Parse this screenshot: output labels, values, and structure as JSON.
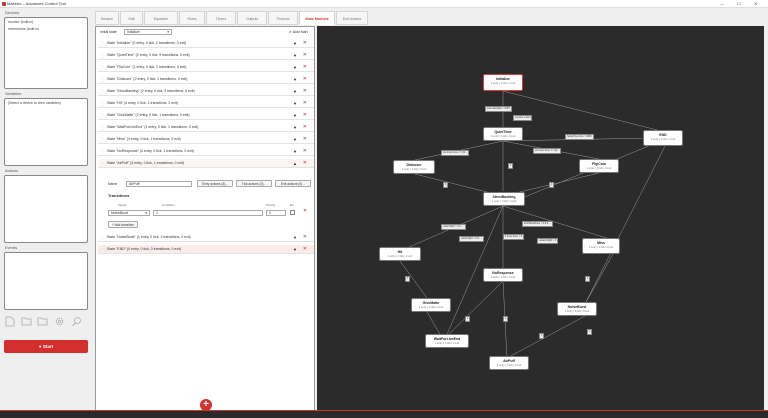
{
  "window": {
    "title": "Maestro – Advanced Control Tool",
    "controls": [
      "—",
      "☐",
      "✕"
    ]
  },
  "sidebar": {
    "devices_label": "Devices",
    "devices": [
      "monitor (built-in)",
      "metronome (built-in)"
    ],
    "variables_label": "Variables",
    "variables_hint": "(Select a device to view variables)",
    "actions_label": "Actions",
    "events_label": "Events",
    "start_label": "● Start",
    "toolbar_icons": [
      "new-file-icon",
      "open-folder-icon",
      "save-folder-icon",
      "settings-gear-icon",
      "search-icon"
    ]
  },
  "tabs": [
    "Session",
    "Edit",
    "Equalizer",
    "Rules",
    "Timers",
    "Outputs",
    "Protocol",
    "State Machine",
    "End Actions"
  ],
  "active_tab": "State Machine",
  "editor": {
    "initial_state_label": "Initial state",
    "initial_state_value": "Initialize",
    "auto_start_label": "✔ Auto start",
    "states": [
      "State \"Initialize\"  (0 entry, 0 tick, 2 transitions, 0 exit)",
      "State \"QuietTime\"  (2 entry, 0 tick, 9 transitions, 0 exit)",
      "State \"FlipCoin\"  (1 entry, 0 tick, 2 transitions, 0 exit)",
      "State \"Dinkuser\"  (2 entry, 0 tick, 1 transitions, 0 exit)",
      "State \"StrunBashing\"  (2 entry, 0 tick, 3 transitions, 0 exit)",
      "State \"Hit\"  (4 entry, 0 tick, 1 transitions, 2 exit)",
      "State \"GiveMatte\"  (2 entry, 0 tick, 1 transitions, 0 exit)",
      "State \"WaitForLiveEnd\"  (1 entry, 0 tick, 1 transitions, 0 exit)",
      "State \"Miss\"  (4 entry, 0 tick, 1 transitions, 0 exit)",
      "State \"NoResponse\"  (4 entry, 0 tick, 1 transitions, 0 exit)",
      "State \"AirPuff\"  (3 entry, 0 tick, 1 transitions, 0 exit)"
    ],
    "expanded": {
      "name_label": "Name",
      "name_value": "AirPuff",
      "entry_actions": "Entry actions (3)...",
      "tick_actions": "Tick actions (0)...",
      "exit_actions": "Exit actions (0)...",
      "transitions_title": "Transitions",
      "cols": [
        "Target",
        "Condition",
        "Priority",
        "En"
      ],
      "row": {
        "target": "NoiseBurst",
        "condition": "1",
        "priority": "0"
      },
      "add_transition": "+ Add transition"
    },
    "after_states": [
      "State \"NoiseBurst\"  (1 entry, 0 tick, 1 transitions, 0 exit)",
      "State \"END\"  (0 entry, 0 tick, 0 transitions, 0 exit)"
    ],
    "add_state": "+"
  },
  "graph": {
    "nodes": [
      {
        "id": "Initialize",
        "sub": "0 entry | 0 tick | 0 exit"
      },
      {
        "id": "QuietTime",
        "sub": "2 entry | 0 tick | 0 exit"
      },
      {
        "id": "END",
        "sub": "0 entry | 0 tick | 0 exit"
      },
      {
        "id": "Dinkuser",
        "sub": "2 entry | 0 tick | 0 exit"
      },
      {
        "id": "FlipCoin",
        "sub": "1 entry | 0 tick | 0 exit"
      },
      {
        "id": "StrunBashing",
        "sub": "2 entry | 0 tick | 0 exit"
      },
      {
        "id": "Hit",
        "sub": "4 entry | 0 tick | 2 exit"
      },
      {
        "id": "Miss",
        "sub": "4 entry | 0 tick | 0 exit"
      },
      {
        "id": "NoResponse",
        "sub": "4 entry | 0 tick | 0 exit"
      },
      {
        "id": "GiveMatte",
        "sub": "2 entry | 0 tick | 0 exit"
      },
      {
        "id": "NoiseBurst",
        "sub": "1 entry | 0 tick | 0 exit"
      },
      {
        "id": "WaitForLiveEnd",
        "sub": "1 entry | 0 tick | 0 exit"
      },
      {
        "id": "AirPuff",
        "sub": "3 entry | 0 tick | 0 exit"
      }
    ],
    "edge_labels": [
      "trial.start(idle) = 1000",
      "session.ended",
      "NoiseTime.time > 3000",
      "pin.inner.done == Q1...",
      "pin.inner.done == Q2...",
      "1",
      "1",
      "1",
      "outlet.flight > 0 & ...",
      "outlet.flight < 0 & ...",
      "limitStimeDone > 0.8 & ...",
      "outletA.flight > 0",
      "if.inner.done > 0",
      "1",
      "1",
      "1",
      "1",
      "1",
      "1"
    ]
  }
}
